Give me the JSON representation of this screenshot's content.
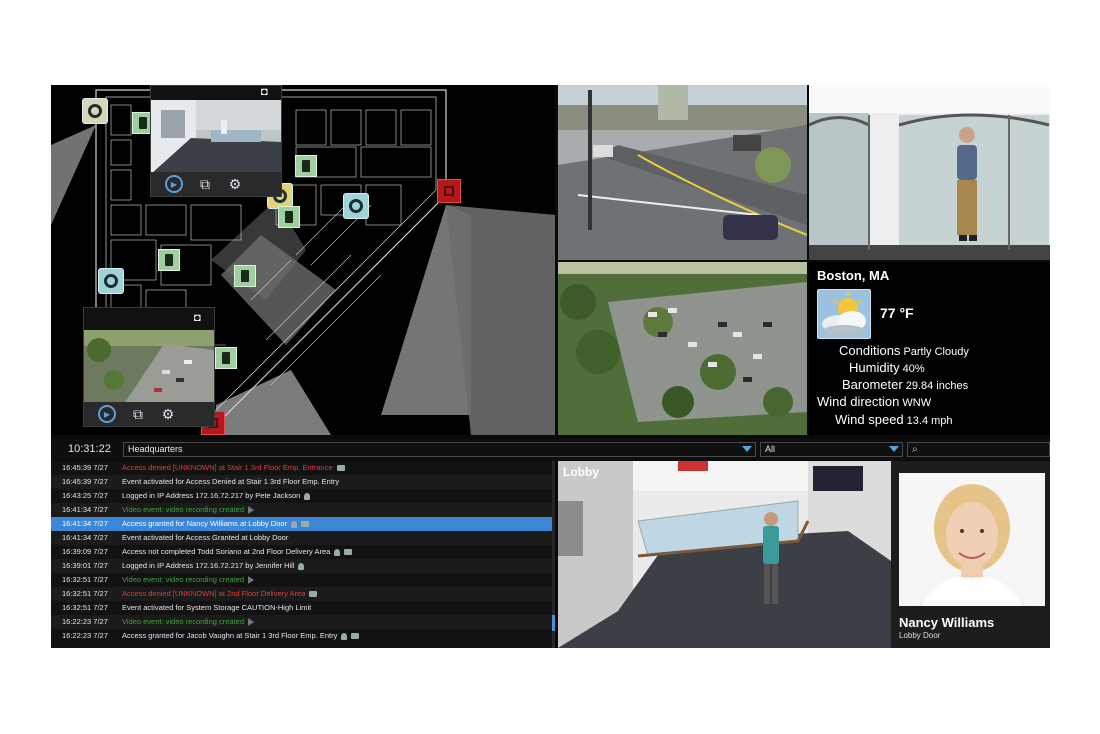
{
  "map": {
    "alarm_color": "#b3181c",
    "camera_color": "#9fcfa0",
    "icons": [
      "camera-icon",
      "dome-camera-icon",
      "alarm-icon",
      "snapshot-icon",
      "play-icon",
      "layouts-icon",
      "settings-icon"
    ]
  },
  "weather": {
    "city": "Boston, MA",
    "temp": "77 °F",
    "conditions_key": "Conditions",
    "conditions_val": "Partly Cloudy",
    "humidity_key": "Humidity",
    "humidity_val": "40%",
    "barometer_key": "Barometer",
    "barometer_val": "29.84 inches",
    "winddir_key": "Wind direction",
    "winddir_val": "WNW",
    "windspeed_key": "Wind speed",
    "windspeed_val": "13.4 mph",
    "icon": "partly-cloudy-icon"
  },
  "toolbar": {
    "time": "10:31:22",
    "site": "Headquarters",
    "filter": "All",
    "search_icon": "search-icon"
  },
  "events": [
    {
      "time": "16:45:39 7/27",
      "text": "Access denied [UNKNOWN] at Stair 1 3rd Floor Emp. Entrance",
      "color": "red"
    },
    {
      "time": "16:45:39 7/27",
      "text": "Event activated for Access Denied at Stair 1 3rd Floor Emp. Entry",
      "color": "white"
    },
    {
      "time": "16:43:25 7/27",
      "text": "Logged in IP Address 172.16.72.217 by Pete Jackson",
      "color": "white"
    },
    {
      "time": "16:41:34 7/27",
      "text": "Video event: video recording created",
      "color": "green"
    },
    {
      "time": "16:41:34 7/27",
      "text": "Access granted for Nancy Williams at Lobby Door",
      "color": "white",
      "selected": true
    },
    {
      "time": "16:41:34 7/27",
      "text": "Event activated for Access Granted at Lobby Door",
      "color": "white"
    },
    {
      "time": "16:39:09 7/27",
      "text": "Access not completed Todd Soriano at 2nd Floor Delivery Area",
      "color": "white"
    },
    {
      "time": "16:39:01 7/27",
      "text": "Logged in IP Address 172.16.72.217 by Jennifer Hill",
      "color": "white"
    },
    {
      "time": "16:32:51 7/27",
      "text": "Video event: video recording created",
      "color": "green"
    },
    {
      "time": "16:32:51 7/27",
      "text": "Access denied [UNKNOWN] at 2nd Floor Delivery Area",
      "color": "red"
    },
    {
      "time": "16:32:51 7/27",
      "text": "Event activated for System Storage CAUTION-High Limit",
      "color": "white"
    },
    {
      "time": "16:22:23 7/27",
      "text": "Video event: video recording created",
      "color": "green"
    },
    {
      "time": "16:22:23 7/27",
      "text": "Access granted for Jacob Vaughn at Stair 1 3rd Floor Emp. Entry",
      "color": "white"
    }
  ],
  "lobby": {
    "label": "Lobby"
  },
  "person": {
    "name": "Nancy Williams",
    "location": "Lobby Door"
  }
}
